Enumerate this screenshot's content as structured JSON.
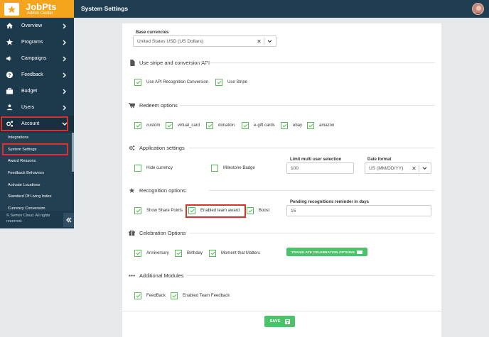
{
  "app": {
    "name": "JobPts",
    "subtitle": "Admin Center"
  },
  "header": {
    "title": "System Settings"
  },
  "sidebar": {
    "items": [
      {
        "label": "Overview",
        "icon": "dashboard-icon"
      },
      {
        "label": "Programs",
        "icon": "star-icon"
      },
      {
        "label": "Campaigns",
        "icon": "bullhorn-icon"
      },
      {
        "label": "Feedback",
        "icon": "question-circle-icon"
      },
      {
        "label": "Budget",
        "icon": "briefcase-icon"
      },
      {
        "label": "Users",
        "icon": "users-icon"
      },
      {
        "label": "Account",
        "icon": "gears-icon"
      }
    ],
    "submenu": [
      "Integrations",
      "System Settings",
      "Award Reasons",
      "Feedback Behaviors",
      "Activate Locations",
      "Standard Of Living Index",
      "Currency Conversion"
    ],
    "footer": "© Semos Cloud. All rights reserved."
  },
  "settings": {
    "base_currencies": {
      "label": "Base currencies",
      "value": "United States USD (US Dollars)"
    },
    "stripe": {
      "title": "Use stripe and conversion API",
      "options": [
        "Use API Recognition Conversion",
        "Use Stripe"
      ]
    },
    "redeem": {
      "title": "Redeem options",
      "options": [
        "custom",
        "virtual_card",
        "donation",
        "e-gift cards",
        "ebay",
        "amazon"
      ]
    },
    "application": {
      "title": "Application settings",
      "options": [
        "Hide currency",
        "Milestone Badge"
      ],
      "limit_label": "Limit multi user selection",
      "limit_value": "100",
      "date_label": "Date format",
      "date_value": "US (MM/DD/YY)"
    },
    "recognition": {
      "title": "Recognition options:",
      "options": [
        "Show Share Points",
        "Enabled team award",
        "Boost"
      ],
      "reminder_label": "Pending recognitions reminder in days",
      "reminder_value": "15"
    },
    "celebration": {
      "title": "Celebration Options",
      "options": [
        "Anniversary",
        "Birthday",
        "Moment that Matters"
      ],
      "translate_button": "TRANSLATE CELEBRATION OPTIONS"
    },
    "additional": {
      "title": "Additional Modules",
      "options": [
        "FeedBack",
        "Enabled Team Feedback"
      ]
    },
    "save_label": "SAVE"
  },
  "colors": {
    "sidebar": "#1d3a4d",
    "brand": "#f4a51c",
    "accent_green": "#5fb85c",
    "highlight": "#e02d2d"
  }
}
